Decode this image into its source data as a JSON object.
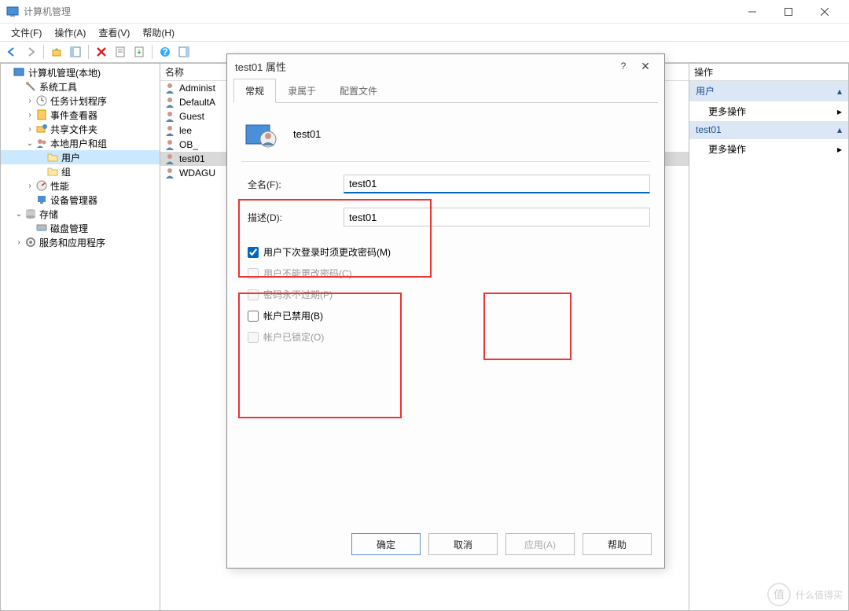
{
  "window": {
    "title": "计算机管理"
  },
  "menubar": [
    {
      "label": "文件(F)"
    },
    {
      "label": "操作(A)"
    },
    {
      "label": "查看(V)"
    },
    {
      "label": "帮助(H)"
    }
  ],
  "tree": {
    "root": "计算机管理(本地)",
    "items": [
      {
        "label": "系统工具",
        "expanded": true,
        "indent": 1,
        "icon": "tools"
      },
      {
        "label": "任务计划程序",
        "expanded": false,
        "indent": 2,
        "icon": "clock",
        "has_children": true
      },
      {
        "label": "事件查看器",
        "expanded": false,
        "indent": 2,
        "icon": "event",
        "has_children": true
      },
      {
        "label": "共享文件夹",
        "expanded": false,
        "indent": 2,
        "icon": "share",
        "has_children": true
      },
      {
        "label": "本地用户和组",
        "expanded": true,
        "indent": 2,
        "icon": "users",
        "has_children": true
      },
      {
        "label": "用户",
        "expanded": false,
        "indent": 3,
        "icon": "folder",
        "has_children": false,
        "selected": true
      },
      {
        "label": "组",
        "expanded": false,
        "indent": 3,
        "icon": "folder",
        "has_children": false
      },
      {
        "label": "性能",
        "expanded": false,
        "indent": 2,
        "icon": "perf",
        "has_children": true
      },
      {
        "label": "设备管理器",
        "expanded": false,
        "indent": 2,
        "icon": "device",
        "has_children": false
      },
      {
        "label": "存储",
        "expanded": true,
        "indent": 1,
        "icon": "storage",
        "has_children": true
      },
      {
        "label": "磁盘管理",
        "expanded": false,
        "indent": 2,
        "icon": "disk",
        "has_children": false
      },
      {
        "label": "服务和应用程序",
        "expanded": false,
        "indent": 1,
        "icon": "services",
        "has_children": true
      }
    ]
  },
  "list": {
    "header": "名称",
    "items": [
      {
        "label": "Administ"
      },
      {
        "label": "DefaultA"
      },
      {
        "label": "Guest"
      },
      {
        "label": "lee"
      },
      {
        "label": "OB_"
      },
      {
        "label": "test01",
        "selected": true
      },
      {
        "label": "WDAGU"
      }
    ]
  },
  "actions": {
    "header": "操作",
    "groups": [
      {
        "title": "用户",
        "items": [
          {
            "label": "更多操作"
          }
        ]
      },
      {
        "title": "test01",
        "items": [
          {
            "label": "更多操作"
          }
        ]
      }
    ]
  },
  "dialog": {
    "title": "test01 属性",
    "tabs": [
      {
        "label": "常规",
        "active": true
      },
      {
        "label": "隶属于"
      },
      {
        "label": "配置文件"
      }
    ],
    "username": "test01",
    "form": {
      "fullname_label": "全名(F):",
      "fullname_value": "test01",
      "desc_label": "描述(D):",
      "desc_value": "test01"
    },
    "checks": [
      {
        "label": "用户下次登录时须更改密码(M)",
        "checked": true,
        "disabled": false
      },
      {
        "label": "用户不能更改密码(C)",
        "checked": false,
        "disabled": true
      },
      {
        "label": "密码永不过期(P)",
        "checked": false,
        "disabled": true
      },
      {
        "label": "帐户已禁用(B)",
        "checked": false,
        "disabled": false
      },
      {
        "label": "帐户已锁定(O)",
        "checked": false,
        "disabled": true
      }
    ],
    "buttons": {
      "ok": "确定",
      "cancel": "取消",
      "apply": "应用(A)",
      "help": "帮助"
    }
  },
  "watermark": {
    "icon_text": "值",
    "text": "什么值得买"
  }
}
